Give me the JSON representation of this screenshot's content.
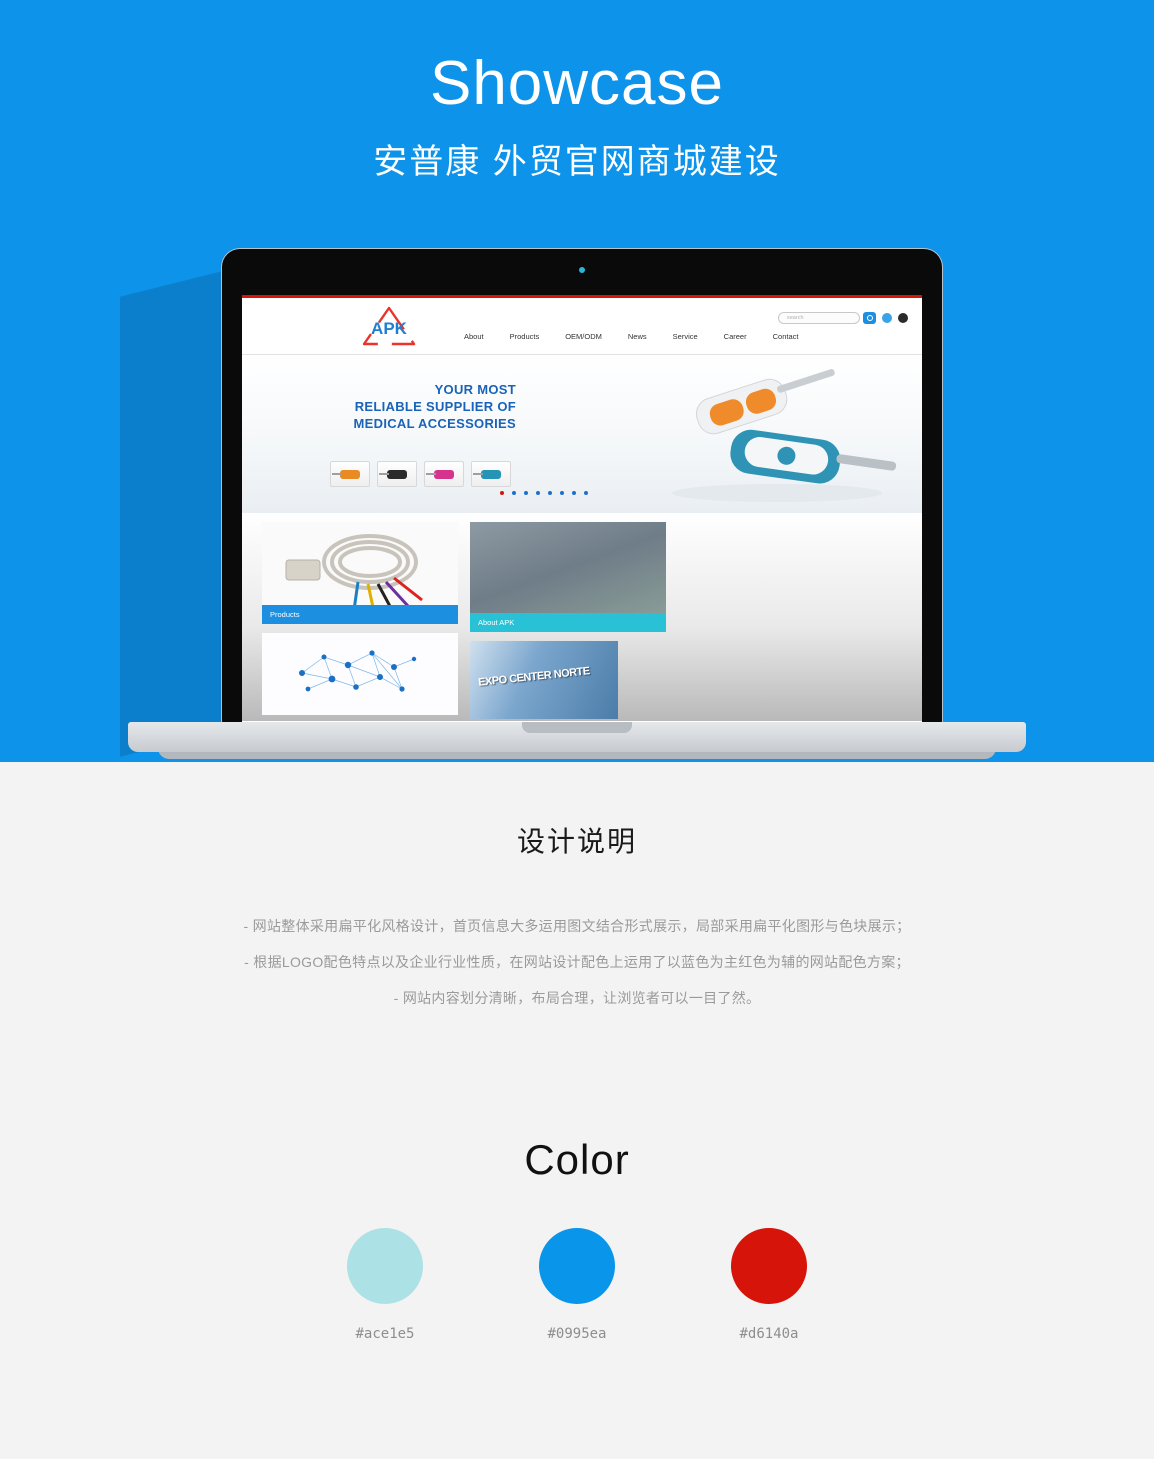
{
  "hero": {
    "title": "Showcase",
    "subtitle": "安普康 外贸官网商城建设",
    "background_color": "#0d93ea"
  },
  "mockup": {
    "device": "laptop",
    "site": {
      "logo_text": "APK",
      "top_accent_color": "#d6140a",
      "nav": [
        {
          "label": "About"
        },
        {
          "label": "Products"
        },
        {
          "label": "OEM/ODM"
        },
        {
          "label": "News"
        },
        {
          "label": "Service"
        },
        {
          "label": "Career"
        },
        {
          "label": "Contact"
        }
      ],
      "search": {
        "placeholder": "search",
        "value": ""
      },
      "banner": {
        "line1": "YOUR MOST",
        "line2": "RELIABLE SUPPLIER OF",
        "line3": "MEDICAL ACCESSORIES",
        "thumbnail_colors": [
          "#e98a22",
          "#2b2b2b",
          "#d6348c",
          "#2594b5"
        ],
        "dots_total": 8,
        "active_dot": 1
      },
      "cards": [
        {
          "caption": "Products",
          "caption_color": "#1d8fe0"
        },
        {
          "caption": "About APK",
          "caption_color": "#29c1d6"
        },
        {
          "caption": "",
          "caption_color": ""
        },
        {
          "caption": "EXPO CENTER NORTE",
          "caption_color": ""
        }
      ]
    }
  },
  "design_section": {
    "title": "设计说明",
    "lines": [
      "- 网站整体采用扁平化风格设计，首页信息大多运用图文结合形式展示，局部采用扁平化图形与色块展示；",
      "- 根据LOGO配色特点以及企业行业性质，在网站设计配色上运用了以蓝色为主红色为辅的网站配色方案；",
      "- 网站内容划分清晰，布局合理，让浏览者可以一目了然。"
    ]
  },
  "color_section": {
    "title": "Color",
    "swatches": [
      {
        "hex": "#ace1e5"
      },
      {
        "hex": "#0995ea"
      },
      {
        "hex": "#d6140a"
      }
    ]
  }
}
